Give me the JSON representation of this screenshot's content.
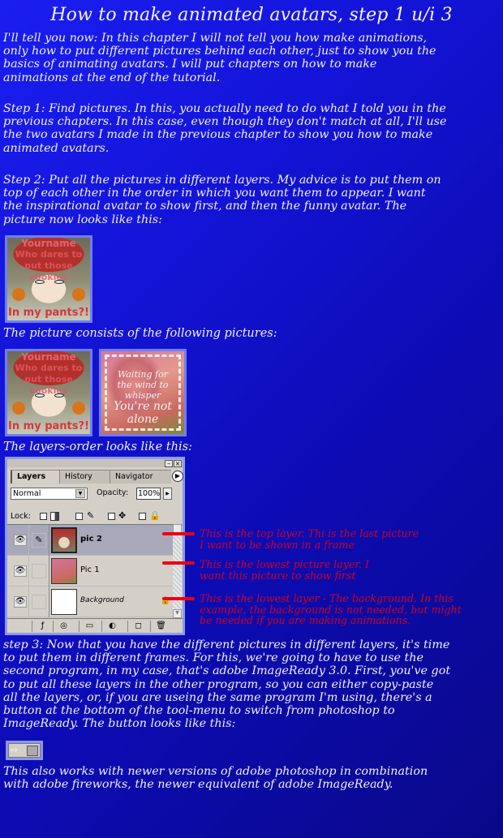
{
  "title": "How to make animated avatars, step 1 u/i 3",
  "intro": "I'll tell you now: In this chapter I will not tell you how make animations,\nonly how to put different pictures behind each other, just to show you the\nbasics of animating avatars. I will put chapters on how to make\nanimations at the end of the tutorial.",
  "step1": "Step 1: Find pictures. In this, you actually need to do what I told you in the\nprevious chapters. In this case, even though they don't match at all, I'll use\nthe two avatars I made in the previous chapter to show you how to make\nanimated avatars.",
  "step2": "Step 2: Put all the pictures in different layers. My advice is to put them on\ntop of each other in the order in which you want them to appear. I want\nthe inspirational avatar to show first, and then the funny avatar. The\npicture now looks like this:",
  "avatar_funny": {
    "line1": "Yourname",
    "line2": "Who dares to",
    "line3": "put those cookies",
    "line4": "In my pants?!"
  },
  "caption_consists": "The picture consists of the following pictures:",
  "avatar_inspirational": {
    "line1": "Waiting for",
    "line2": "the wind to",
    "line3": "whisper",
    "line4": "You're not",
    "line5": "alone"
  },
  "caption_layers_order": "The layers-order looks like this:",
  "layers_panel": {
    "tabs": [
      "Layers",
      "History",
      "Navigator"
    ],
    "active_tab": "Layers",
    "blend_mode": "Normal",
    "opacity_label": "Opacity:",
    "opacity_value": "100%",
    "lock_label": "Lock:",
    "layers": [
      {
        "name": "pic 2",
        "selected": true,
        "visible": true,
        "brush": true
      },
      {
        "name": "Pic 1",
        "selected": false,
        "visible": true,
        "brush": false
      },
      {
        "name": "Background",
        "selected": false,
        "visible": true,
        "brush": false,
        "locked": true
      }
    ]
  },
  "annotations": [
    "This is the top layer. Thi is the last picture\nI want to be shown in a frame",
    "This is the lowest picture layer. I\nwant this picture to show first",
    "This is the lowest layer - The background. In this\nexample, the background is not needed, but might\nbe needed if you are making animations."
  ],
  "step3": "step 3: Now that you have the different pictures in different layers, it's time\nto put them in different frames. For this, we're going to have to use the\nsecond program, in my case, that's adobe ImageReady 3.0. First, you've got\nto put all these layers in the other program, so you can either copy-paste\nall the layers, or, if you are useing the same program I'm using, there's a\nbutton at the bottom of the tool-menu to switch from photoshop to\nImageReady. The button looks like this:",
  "closing": "This also works with newer versions of adobe photoshop in combination\nwith adobe fireworks, the newer equivalent of adobe ImageReady.",
  "colors": {
    "background_start": "#1a1ef0",
    "background_end": "#0a0888",
    "annotation_text": "#cc0022",
    "pointer_line": "#ee0010"
  }
}
